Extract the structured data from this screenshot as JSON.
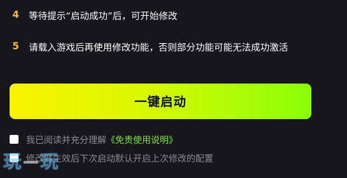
{
  "steps": [
    {
      "number": "4",
      "text": "等待提示“启动成功”后，可开始修改"
    },
    {
      "number": "5",
      "text": "请载入游戏后再使用修改功能，否则部分功能可能无法成功激活"
    }
  ],
  "launch_button": {
    "label": "一键启动"
  },
  "agreement": {
    "text": "我已阅读并充分理解",
    "link": "《免责使用说明》"
  },
  "auto_config": {
    "text": "修改器生效后下次启动默认开启上次修改的配置"
  },
  "watermark": {
    "char_left": "玩",
    "char_right": "玩"
  },
  "colors": {
    "background": "#17171b",
    "step_number": "#f5b93a",
    "button_gradient_start": "#f9f200",
    "button_gradient_end": "#8aff08",
    "link": "#7be33a",
    "muted_text": "#8a8a8f"
  }
}
